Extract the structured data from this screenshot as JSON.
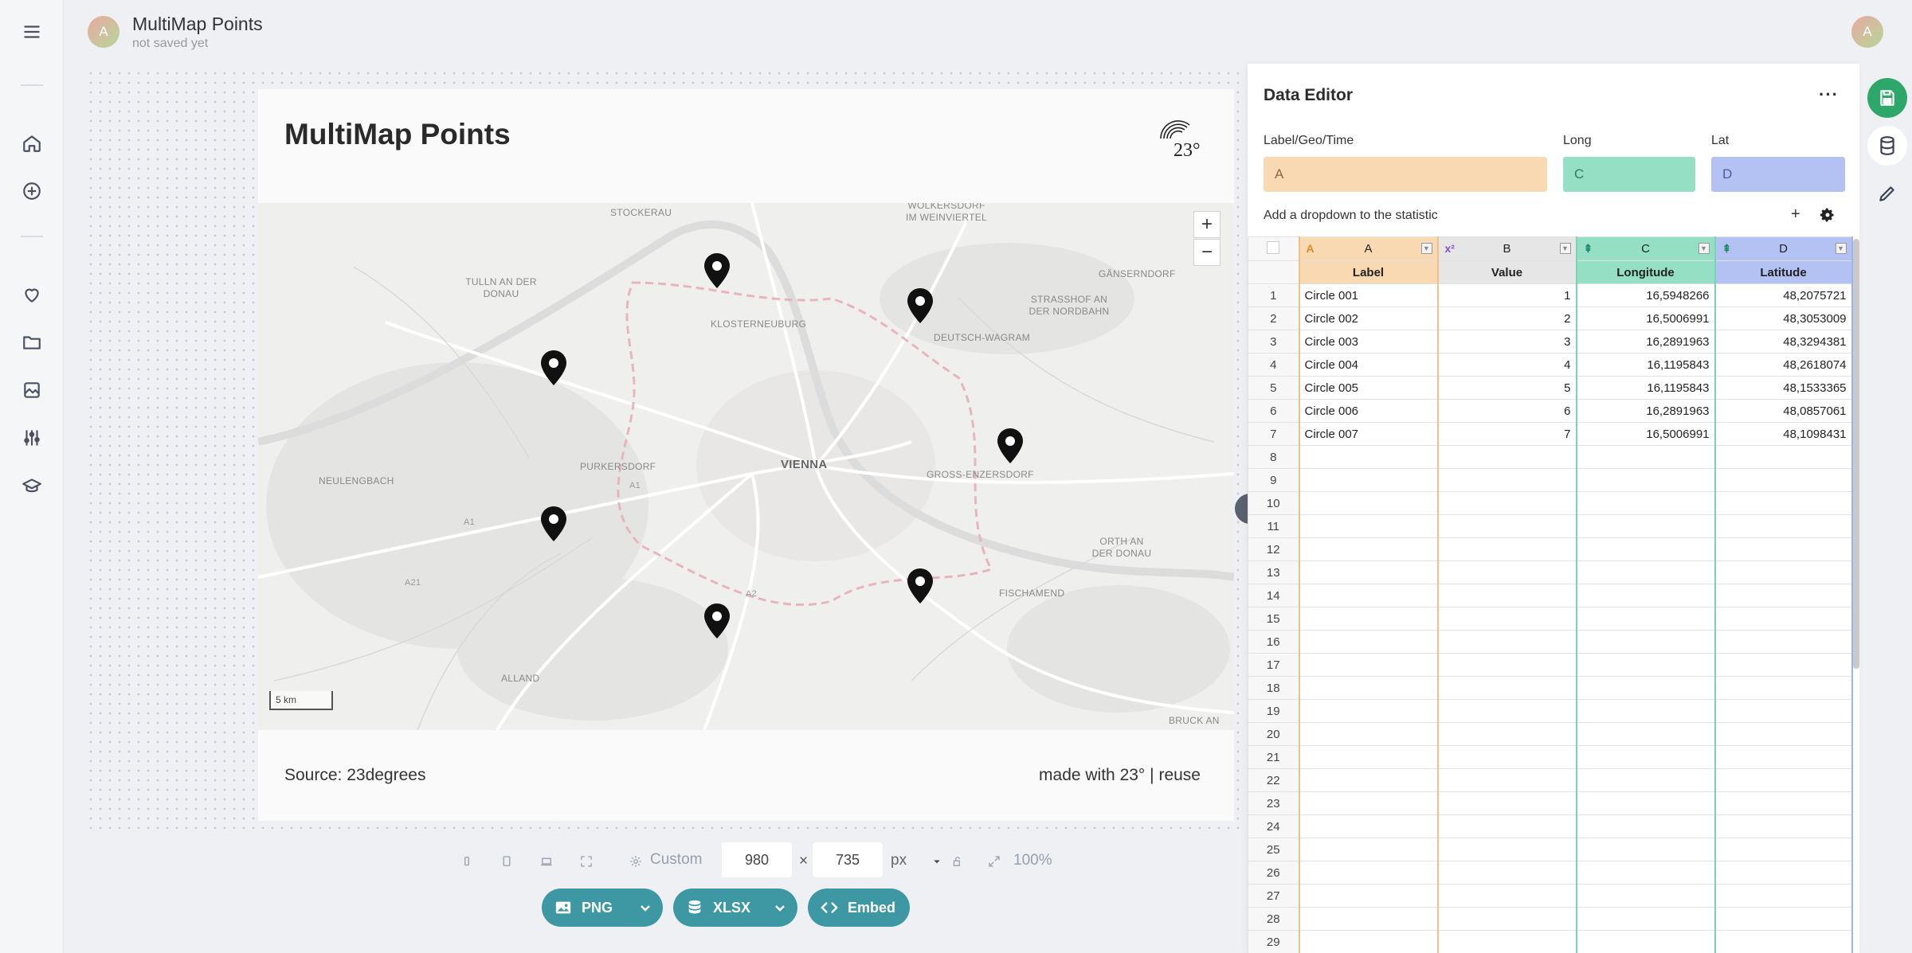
{
  "header": {
    "avatar_letter": "A",
    "title": "MultiMap Points",
    "subtitle": "not saved yet",
    "user_avatar_letter": "A"
  },
  "sidebar": {
    "items": [
      {
        "icon": "menu-icon"
      },
      {
        "icon": "home-icon"
      },
      {
        "icon": "add-circle-icon"
      },
      {
        "icon": "heart-icon"
      },
      {
        "icon": "folder-icon"
      },
      {
        "icon": "image-icon"
      },
      {
        "icon": "sliders-icon"
      },
      {
        "icon": "graduation-cap-icon"
      }
    ]
  },
  "card": {
    "title": "MultiMap Points",
    "logo_text": "23°",
    "source": "Source: 23degrees",
    "made_with": "made with 23° | reuse"
  },
  "map": {
    "places": [
      "STOCKERAU",
      "WOLKERSDORF IM WEINVIERTEL",
      "TULLN AN DER DONAU",
      "KLOSTERNEUBURG",
      "GÄNSERNDORF",
      "STRASSHOF AN DER NORDBAHN",
      "DEUTSCH-WAGRAM",
      "NEULENGBACH",
      "PURKERSDORF",
      "VIENNA",
      "GROSS-ENZERSDORF",
      "ORTH AN DER DONAU",
      "FISCHAMEND",
      "ALLAND",
      "BRUCK AN"
    ],
    "roads": [
      "A1",
      "A1",
      "A21",
      "A2"
    ],
    "zoom_in": "+",
    "zoom_out": "−",
    "scale": "5 km",
    "points": [
      {
        "label": "Circle 001",
        "lon": 16.5948266,
        "lat": 48.2075721
      },
      {
        "label": "Circle 002",
        "lon": 16.5006991,
        "lat": 48.3053009
      },
      {
        "label": "Circle 003",
        "lon": 16.2891963,
        "lat": 48.3294381
      },
      {
        "label": "Circle 004",
        "lon": 16.1195843,
        "lat": 48.2618074
      },
      {
        "label": "Circle 005",
        "lon": 16.1195843,
        "lat": 48.1533365
      },
      {
        "label": "Circle 006",
        "lon": 16.2891963,
        "lat": 48.0857061
      },
      {
        "label": "Circle 007",
        "lon": 16.5006991,
        "lat": 48.1098431
      }
    ]
  },
  "toolbar": {
    "custom": "Custom",
    "width": "980",
    "times": "×",
    "height": "735",
    "unit": "px",
    "zoom": "100%",
    "png": "PNG",
    "xlsx": "XLSX",
    "embed": "Embed"
  },
  "editor": {
    "title": "Data Editor",
    "more": "···",
    "mapping": [
      {
        "label": "Label/Geo/Time",
        "value": "A",
        "color": "#f9d9b2"
      },
      {
        "label": "Long",
        "value": "C",
        "color": "#95e0c5"
      },
      {
        "label": "Lat",
        "value": "D",
        "color": "#b4c2f3"
      }
    ],
    "dropdown_hint": "Add a dropdown to the statistic",
    "plus": "+",
    "columns": [
      {
        "letter": "A",
        "type": "A",
        "name": "Label"
      },
      {
        "letter": "B",
        "type": "x²",
        "name": "Value"
      },
      {
        "letter": "C",
        "type": "⇞",
        "name": "Longitude"
      },
      {
        "letter": "D",
        "type": "⇞",
        "name": "Latitude"
      }
    ],
    "rows": [
      [
        "Circle 001",
        "1",
        "16,5948266",
        "48,2075721"
      ],
      [
        "Circle 002",
        "2",
        "16,5006991",
        "48,3053009"
      ],
      [
        "Circle 003",
        "3",
        "16,2891963",
        "48,3294381"
      ],
      [
        "Circle 004",
        "4",
        "16,1195843",
        "48,2618074"
      ],
      [
        "Circle 005",
        "5",
        "16,1195843",
        "48,1533365"
      ],
      [
        "Circle 006",
        "6",
        "16,2891963",
        "48,0857061"
      ],
      [
        "Circle 007",
        "7",
        "16,5006991",
        "48,1098431"
      ]
    ],
    "row_count": 29
  },
  "colors": {
    "accent": "#3d98a4",
    "save": "#2ea86a",
    "col_a": "#f9d9b2",
    "col_c": "#95e0c5",
    "col_d": "#b4c2f3"
  }
}
